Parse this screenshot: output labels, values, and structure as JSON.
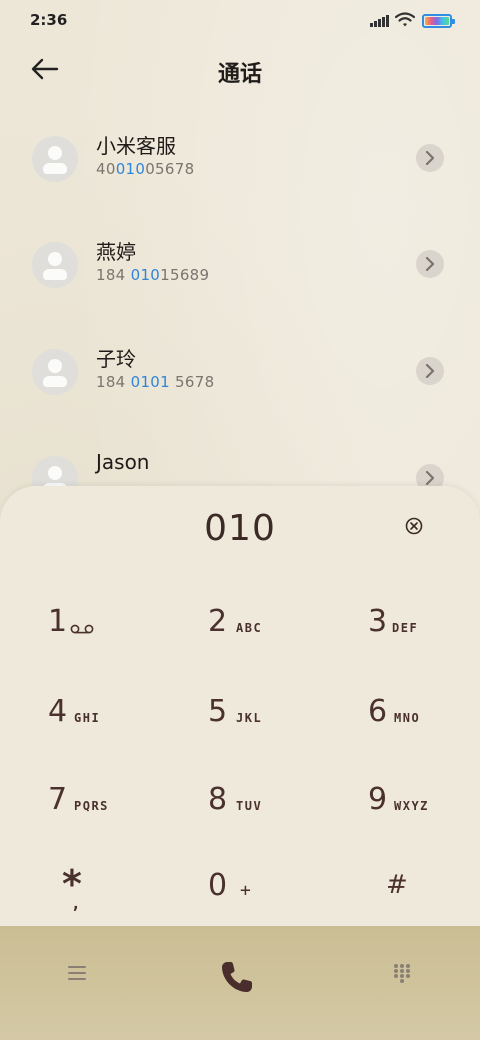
{
  "status_bar": {
    "time": "2:36"
  },
  "header": {
    "title": "通话"
  },
  "contacts": [
    {
      "name": "小米客服",
      "number_parts": [
        "40",
        "010",
        "05678"
      ]
    },
    {
      "name": "燕婷",
      "number_parts": [
        "184 ",
        "010",
        "15689"
      ]
    },
    {
      "name": "子玲",
      "number_parts": [
        "184 ",
        "0101",
        " 5678"
      ]
    },
    {
      "name": "Jason"
    }
  ],
  "dialer": {
    "input": "010",
    "keys": [
      {
        "digit": "1",
        "letters": ""
      },
      {
        "digit": "2",
        "letters": "ABC"
      },
      {
        "digit": "3",
        "letters": "DEF"
      },
      {
        "digit": "4",
        "letters": "GHI"
      },
      {
        "digit": "5",
        "letters": "JKL"
      },
      {
        "digit": "6",
        "letters": "MNO"
      },
      {
        "digit": "7",
        "letters": "PQRS"
      },
      {
        "digit": "8",
        "letters": "TUV"
      },
      {
        "digit": "9",
        "letters": "WXYZ"
      },
      {
        "digit": "*",
        "letters": ","
      },
      {
        "digit": "0",
        "letters": "+"
      },
      {
        "digit": "#",
        "letters": ""
      }
    ]
  },
  "icons": {
    "back": "back-arrow-icon",
    "chevron": "chevron-right-icon",
    "clear": "clear-circle-x-icon",
    "voicemail": "voicemail-icon",
    "menu": "menu-icon",
    "call": "phone-icon",
    "keypad": "keypad-icon"
  },
  "colors": {
    "highlight": "#2f86d9",
    "accent_text": "#4a312d",
    "background": "#ede7d8"
  }
}
